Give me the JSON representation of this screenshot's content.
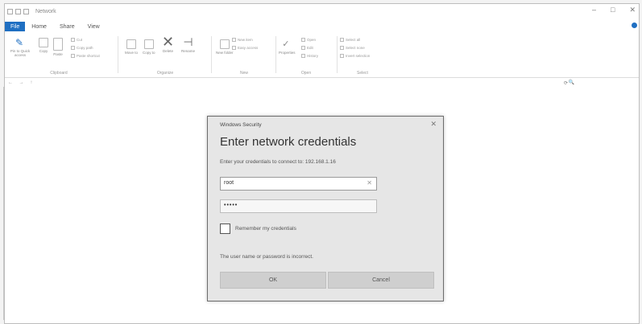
{
  "window": {
    "title": "Network",
    "controls": {
      "minimize": "–",
      "maximize": "□",
      "close": "✕"
    }
  },
  "menu": {
    "file": "File",
    "items": [
      "Home",
      "Share",
      "View"
    ]
  },
  "ribbon": {
    "clipboard": {
      "label": "Clipboard",
      "pin": "Pin to Quick access",
      "copy": "Copy",
      "paste": "Paste",
      "cut": "Cut",
      "copy_path": "Copy path",
      "paste_shortcut": "Paste shortcut"
    },
    "organize": {
      "label": "Organize",
      "move_to": "Move to",
      "copy_to": "Copy to",
      "delete": "Delete",
      "rename": "Rename"
    },
    "new": {
      "label": "New",
      "new_folder": "New folder",
      "new_item": "New item",
      "easy_access": "Easy access"
    },
    "open": {
      "label": "Open",
      "properties": "Properties",
      "open": "Open",
      "edit": "Edit",
      "history": "History"
    },
    "select": {
      "label": "Select",
      "select_all": "Select all",
      "select_none": "Select none",
      "invert": "Invert selection"
    }
  },
  "address": {
    "nav": "← → ↑",
    "path": "",
    "refresh": "⟳",
    "search": "🔍"
  },
  "dialog": {
    "header": "Windows Security",
    "close": "✕",
    "title": "Enter network credentials",
    "subtitle": "Enter your credentials to connect to: 192.168.1.16",
    "username_value": "root",
    "password_value": "•••••",
    "remember_label": "Remember my credentials",
    "error": "The user name or password is incorrect.",
    "ok_label": "OK",
    "cancel_label": "Cancel"
  }
}
